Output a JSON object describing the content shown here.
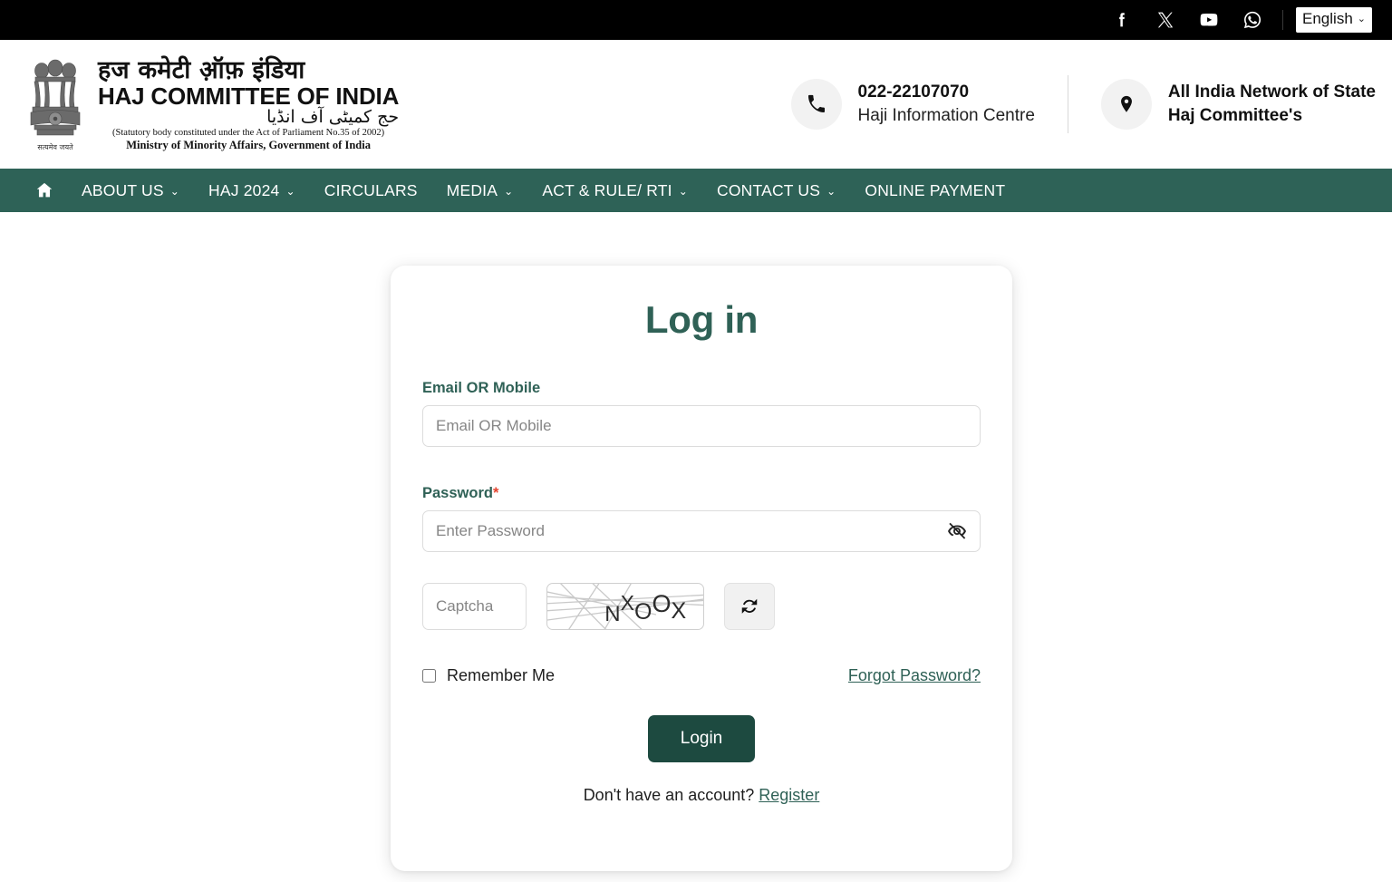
{
  "topbar": {
    "social": [
      {
        "name": "facebook-icon",
        "label": "Facebook"
      },
      {
        "name": "x-twitter-icon",
        "label": "X"
      },
      {
        "name": "youtube-icon",
        "label": "YouTube"
      },
      {
        "name": "whatsapp-icon",
        "label": "WhatsApp"
      }
    ],
    "language": {
      "selected": "English",
      "caret": "⌄",
      "options": [
        "English"
      ]
    }
  },
  "header": {
    "brand": {
      "hindi": "हज कमेटी ऑ़फ़ इंडिया",
      "english": "HAJ COMMITTEE OF INDIA",
      "urdu": "حج کمیٹی آف انڈیا",
      "statutory": "(Statutory body constituted under the Act of Parliament No.35 of 2002)",
      "ministry": "Ministry of Minority Affairs, Government of India",
      "emblem_motto": "सत्यमेव जयते"
    },
    "contacts": [
      {
        "icon": "phone-icon",
        "primary": "022-22107070",
        "secondary": "Haji Information Centre"
      },
      {
        "icon": "location-pin-icon",
        "primary": "All India Network of State",
        "secondary": "Haj Committee's"
      }
    ]
  },
  "nav": {
    "home_icon": "home-icon",
    "items": [
      {
        "label": "ABOUT US",
        "caret": true
      },
      {
        "label": "HAJ 2024",
        "caret": true
      },
      {
        "label": "CIRCULARS",
        "caret": false
      },
      {
        "label": "MEDIA",
        "caret": true
      },
      {
        "label": "ACT & RULE/ RTI",
        "caret": true
      },
      {
        "label": "CONTACT US",
        "caret": true
      },
      {
        "label": "ONLINE PAYMENT",
        "caret": false
      }
    ],
    "caret_glyph": "⌄"
  },
  "login": {
    "title": "Log in",
    "email_label": "Email OR Mobile",
    "email_placeholder": "Email OR Mobile",
    "email_value": "",
    "password_label": "Password",
    "password_required_mark": "*",
    "password_placeholder": "Enter Password",
    "password_value": "",
    "toggle_password_icon": "eye-slash-icon",
    "captcha_placeholder": "Captcha",
    "captcha_value": "",
    "captcha_text": "NXOOX",
    "captcha_chars": [
      "N",
      "X",
      "O",
      "O",
      "X"
    ],
    "refresh_icon": "refresh-icon",
    "remember_label": "Remember Me",
    "remember_checked": false,
    "forgot_label": "Forgot Password?",
    "submit_label": "Login",
    "register_prompt": "Don't have an account?",
    "register_label": "Register"
  },
  "colors": {
    "nav_green": "#2e6257",
    "button_green": "#1d4a40",
    "heading_green": "#2f6156",
    "topbar_black": "#000000",
    "required_red": "#e5452f"
  }
}
